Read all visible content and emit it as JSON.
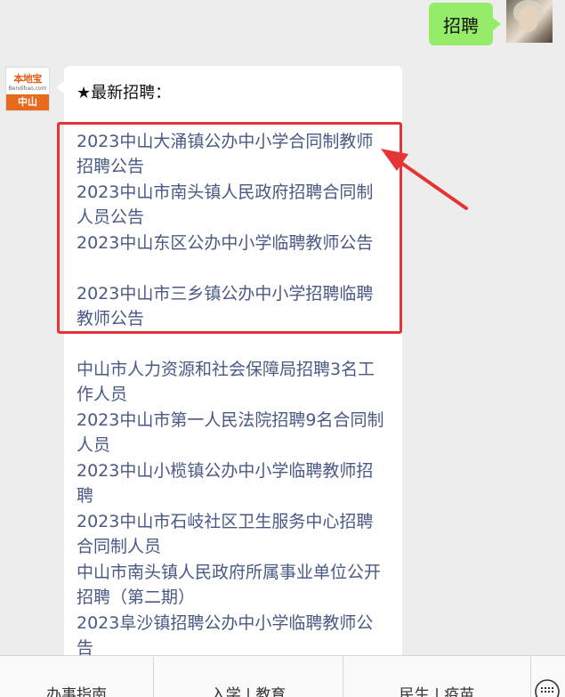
{
  "user_message": {
    "text": "招聘"
  },
  "bot": {
    "avatar_logo": "本地宝",
    "avatar_domain": "Bendibao.com",
    "avatar_city": "中山",
    "title": "★最新招聘："
  },
  "highlighted_links": [
    "2023中山大涌镇公办中小学合同制教师招聘公告",
    "2023中山市南头镇人民政府招聘合同制人员公告",
    "2023中山东区公办中小学临聘教师公告",
    "2023中山市三乡镇公办中小学招聘临聘教师公告"
  ],
  "links": [
    "中山市人力资源和社会保障局招聘3名工作人员",
    "2023中山市第一人民法院招聘9名合同制人员",
    "2023中山小榄镇公办中小学临聘教师招聘",
    "2023中山市石岐社区卫生服务中心招聘合同制人员",
    "中山市南头镇人民政府所属事业单位公开招聘（第二期）",
    "2023阜沙镇招聘公办中小学临聘教师公告"
  ],
  "menu": [
    {
      "label": "办事指南"
    },
    {
      "label": "入学 | 教育"
    },
    {
      "label": "民生 | 疫苗"
    }
  ],
  "colors": {
    "background": "#ededed",
    "user_bubble": "#95ec69",
    "link": "#4a5a85",
    "highlight": "#e63436"
  },
  "icons": [
    "user-avatar",
    "bot-avatar",
    "red-arrow-icon",
    "keyboard-icon"
  ]
}
